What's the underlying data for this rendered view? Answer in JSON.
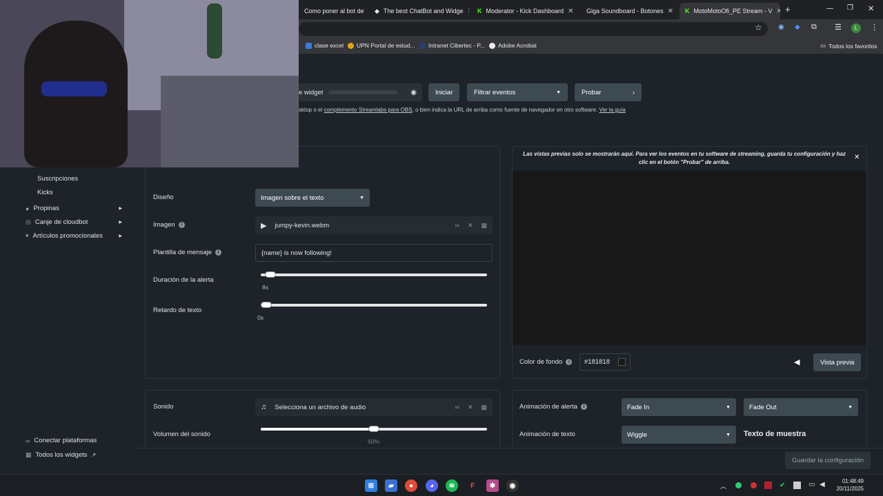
{
  "browser": {
    "tabs": [
      {
        "title": "Como poner al bot de"
      },
      {
        "title": "The best ChatBot and Widge"
      },
      {
        "title": "Moderator - Kick Dashboard"
      },
      {
        "title": "Giga Soundboard - Botones"
      },
      {
        "title": "MotoMotoOfi_PE Stream - V"
      }
    ],
    "new_tab": "+",
    "bookmarks": [
      "clase excel",
      "UPN Portal de estud...",
      "Intranet Cibertec - P...",
      "Adobe Acrobat"
    ],
    "all_bookmarks": "Todos los favoritos",
    "profile_initial": "L"
  },
  "toolbar": {
    "widget_url_label": "e widget",
    "iniciar": "Iniciar",
    "filtrar": "Filtrar eventos",
    "probar": "Probar",
    "help_pre": "sktop o el",
    "help_link1": "complemento Streamlabs para OBS",
    "help_mid": ", o bien indica la URL de arriba como fuente de navegador en otro software.",
    "help_link2": "Ver la guía"
  },
  "sidebar": {
    "items": [
      {
        "label": "Suscripciones"
      },
      {
        "label": "Kicks"
      },
      {
        "label": "Propinas",
        "icon": "tip-icon"
      },
      {
        "label": "Canje de cloudbot",
        "icon": "cloudbot-icon"
      },
      {
        "label": "Artículos promocionales",
        "icon": "shirt-icon"
      }
    ],
    "connect": "Conectar plataformas",
    "all_widgets": "Todos los widgets"
  },
  "settings": {
    "diseno_label": "Diseño",
    "diseno_value": "Imagen sobre el texto",
    "imagen_label": "Imagen",
    "imagen_file": "jumpy-kevin.webm",
    "plantilla_label": "Plantilla de mensaje",
    "plantilla_value": "{name} is now following!",
    "duracion_label": "Duración de la alerta",
    "duracion_value": "8s",
    "duracion_fraction": 0.02,
    "retardo_label": "Retardo de texto",
    "retardo_value": "0s",
    "retardo_fraction": 0.0
  },
  "sound": {
    "sonido_label": "Sonido",
    "sonido_placeholder": "Selecciona un archivo de audio",
    "volumen_label": "Volumen del sonido",
    "volumen_value": "50%",
    "volumen_fraction": 0.5
  },
  "preview": {
    "notice": "Las vistas previas solo se mostrarán aquí. Para ver los eventos en tu software de streaming, guarda tu configuración y haz clic en el botón \"Probar\" de arriba.",
    "bg_label": "Color de fondo",
    "bg_value": "#181818",
    "preview_button": "Vista previa"
  },
  "animation": {
    "alerta_label": "Animación de alerta",
    "alerta_in": "Fade In",
    "alerta_out": "Fade Out",
    "texto_label": "Animación de texto",
    "texto_value": "Wiggle",
    "sample": "Texto de muestra"
  },
  "footer": {
    "save": "Guardar la configuración"
  },
  "taskbar": {
    "time": "01:48:49",
    "date": "20/11/2025"
  },
  "colors": {
    "accent_teal": "#2a7a74",
    "panel_bg": "#1d2329",
    "button_grey": "#3e4a52"
  }
}
